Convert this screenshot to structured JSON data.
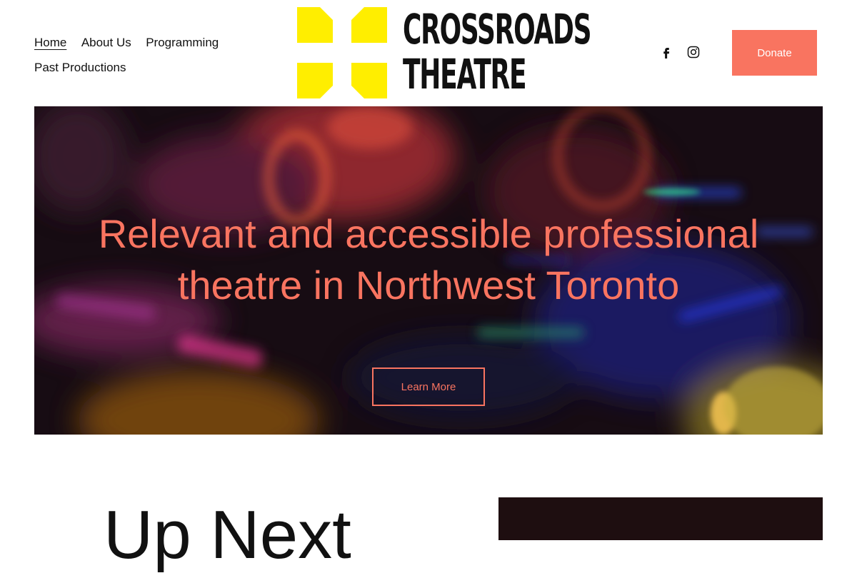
{
  "header": {
    "nav": {
      "home": "Home",
      "about": "About Us",
      "programming": "Programming",
      "past": "Past Productions"
    },
    "logo": {
      "line1": "CROSSROADS",
      "line2": "THEATRE"
    },
    "social": [
      "facebook-icon",
      "instagram-icon"
    ],
    "donate_label": "Donate"
  },
  "hero": {
    "title_line1": "Relevant and accessible professional",
    "title_line2": "theatre in Northwest Toronto",
    "cta_label": "Learn More"
  },
  "next_section": {
    "heading": "Up Next"
  },
  "colors": {
    "accent": "#f97460",
    "logo_yellow": "#ffee00",
    "text": "#111111"
  }
}
